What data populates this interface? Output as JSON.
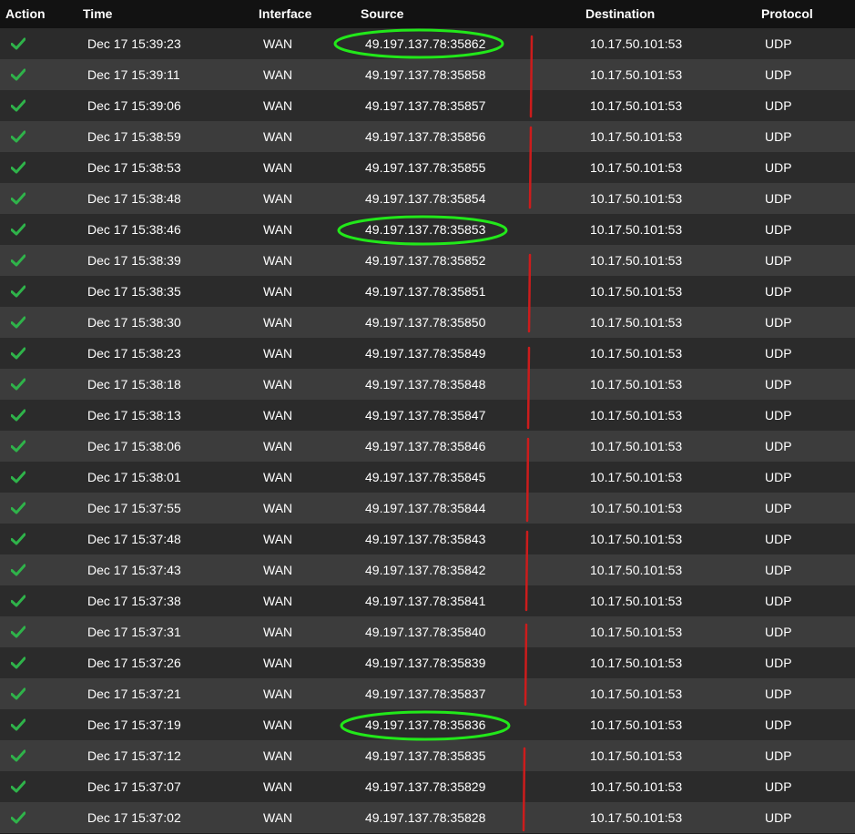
{
  "columns": {
    "action": "Action",
    "time": "Time",
    "interface": "Interface",
    "source": "Source",
    "destination": "Destination",
    "protocol": "Protocol"
  },
  "colors": {
    "pass_check": "#2fb34a",
    "highlight_ellipse": "#22e81a",
    "separator_mark": "#cc1c1c"
  },
  "rows": [
    {
      "action_icon": "check-icon",
      "time": "Dec 17 15:39:23",
      "interface": "WAN",
      "source": "49.197.137.78:35862",
      "destination": "10.17.50.101:53",
      "protocol": "UDP"
    },
    {
      "action_icon": "check-icon",
      "time": "Dec 17 15:39:11",
      "interface": "WAN",
      "source": "49.197.137.78:35858",
      "destination": "10.17.50.101:53",
      "protocol": "UDP"
    },
    {
      "action_icon": "check-icon",
      "time": "Dec 17 15:39:06",
      "interface": "WAN",
      "source": "49.197.137.78:35857",
      "destination": "10.17.50.101:53",
      "protocol": "UDP"
    },
    {
      "action_icon": "check-icon",
      "time": "Dec 17 15:38:59",
      "interface": "WAN",
      "source": "49.197.137.78:35856",
      "destination": "10.17.50.101:53",
      "protocol": "UDP"
    },
    {
      "action_icon": "check-icon",
      "time": "Dec 17 15:38:53",
      "interface": "WAN",
      "source": "49.197.137.78:35855",
      "destination": "10.17.50.101:53",
      "protocol": "UDP"
    },
    {
      "action_icon": "check-icon",
      "time": "Dec 17 15:38:48",
      "interface": "WAN",
      "source": "49.197.137.78:35854",
      "destination": "10.17.50.101:53",
      "protocol": "UDP"
    },
    {
      "action_icon": "check-icon",
      "time": "Dec 17 15:38:46",
      "interface": "WAN",
      "source": "49.197.137.78:35853",
      "destination": "10.17.50.101:53",
      "protocol": "UDP"
    },
    {
      "action_icon": "check-icon",
      "time": "Dec 17 15:38:39",
      "interface": "WAN",
      "source": "49.197.137.78:35852",
      "destination": "10.17.50.101:53",
      "protocol": "UDP"
    },
    {
      "action_icon": "check-icon",
      "time": "Dec 17 15:38:35",
      "interface": "WAN",
      "source": "49.197.137.78:35851",
      "destination": "10.17.50.101:53",
      "protocol": "UDP"
    },
    {
      "action_icon": "check-icon",
      "time": "Dec 17 15:38:30",
      "interface": "WAN",
      "source": "49.197.137.78:35850",
      "destination": "10.17.50.101:53",
      "protocol": "UDP"
    },
    {
      "action_icon": "check-icon",
      "time": "Dec 17 15:38:23",
      "interface": "WAN",
      "source": "49.197.137.78:35849",
      "destination": "10.17.50.101:53",
      "protocol": "UDP"
    },
    {
      "action_icon": "check-icon",
      "time": "Dec 17 15:38:18",
      "interface": "WAN",
      "source": "49.197.137.78:35848",
      "destination": "10.17.50.101:53",
      "protocol": "UDP"
    },
    {
      "action_icon": "check-icon",
      "time": "Dec 17 15:38:13",
      "interface": "WAN",
      "source": "49.197.137.78:35847",
      "destination": "10.17.50.101:53",
      "protocol": "UDP"
    },
    {
      "action_icon": "check-icon",
      "time": "Dec 17 15:38:06",
      "interface": "WAN",
      "source": "49.197.137.78:35846",
      "destination": "10.17.50.101:53",
      "protocol": "UDP"
    },
    {
      "action_icon": "check-icon",
      "time": "Dec 17 15:38:01",
      "interface": "WAN",
      "source": "49.197.137.78:35845",
      "destination": "10.17.50.101:53",
      "protocol": "UDP"
    },
    {
      "action_icon": "check-icon",
      "time": "Dec 17 15:37:55",
      "interface": "WAN",
      "source": "49.197.137.78:35844",
      "destination": "10.17.50.101:53",
      "protocol": "UDP"
    },
    {
      "action_icon": "check-icon",
      "time": "Dec 17 15:37:48",
      "interface": "WAN",
      "source": "49.197.137.78:35843",
      "destination": "10.17.50.101:53",
      "protocol": "UDP"
    },
    {
      "action_icon": "check-icon",
      "time": "Dec 17 15:37:43",
      "interface": "WAN",
      "source": "49.197.137.78:35842",
      "destination": "10.17.50.101:53",
      "protocol": "UDP"
    },
    {
      "action_icon": "check-icon",
      "time": "Dec 17 15:37:38",
      "interface": "WAN",
      "source": "49.197.137.78:35841",
      "destination": "10.17.50.101:53",
      "protocol": "UDP"
    },
    {
      "action_icon": "check-icon",
      "time": "Dec 17 15:37:31",
      "interface": "WAN",
      "source": "49.197.137.78:35840",
      "destination": "10.17.50.101:53",
      "protocol": "UDP"
    },
    {
      "action_icon": "check-icon",
      "time": "Dec 17 15:37:26",
      "interface": "WAN",
      "source": "49.197.137.78:35839",
      "destination": "10.17.50.101:53",
      "protocol": "UDP"
    },
    {
      "action_icon": "check-icon",
      "time": "Dec 17 15:37:21",
      "interface": "WAN",
      "source": "49.197.137.78:35837",
      "destination": "10.17.50.101:53",
      "protocol": "UDP"
    },
    {
      "action_icon": "check-icon",
      "time": "Dec 17 15:37:19",
      "interface": "WAN",
      "source": "49.197.137.78:35836",
      "destination": "10.17.50.101:53",
      "protocol": "UDP"
    },
    {
      "action_icon": "check-icon",
      "time": "Dec 17 15:37:12",
      "interface": "WAN",
      "source": "49.197.137.78:35835",
      "destination": "10.17.50.101:53",
      "protocol": "UDP"
    },
    {
      "action_icon": "check-icon",
      "time": "Dec 17 15:37:07",
      "interface": "WAN",
      "source": "49.197.137.78:35829",
      "destination": "10.17.50.101:53",
      "protocol": "UDP"
    },
    {
      "action_icon": "check-icon",
      "time": "Dec 17 15:37:02",
      "interface": "WAN",
      "source": "49.197.137.78:35828",
      "destination": "10.17.50.101:53",
      "protocol": "UDP"
    }
  ]
}
